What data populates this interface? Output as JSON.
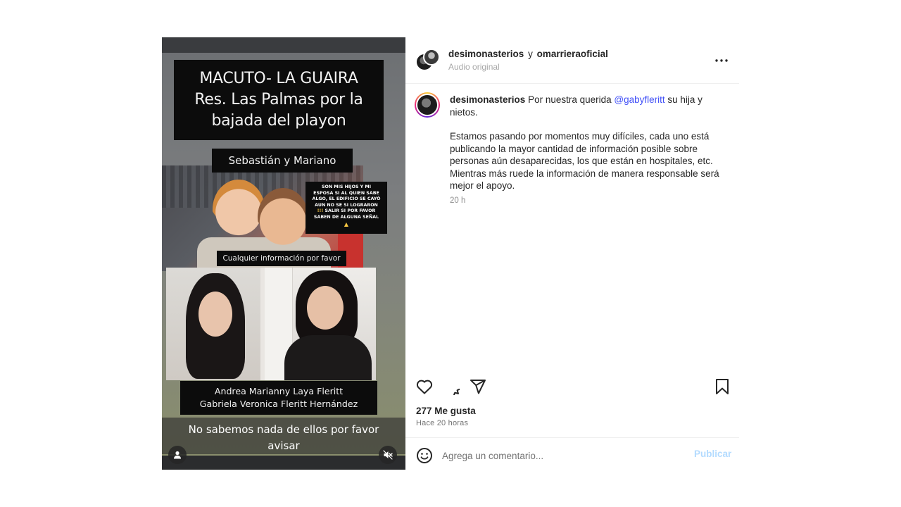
{
  "media": {
    "title_lines": [
      "MACUTO- LA GUAIRA",
      "Res. Las Palmas por la",
      "bajada del playon"
    ],
    "names_label": "Sebastián y Mariano",
    "note_lines": [
      "SON MIS HIJOS Y MI",
      "ESPOSA SI AL QUIEN SABE",
      "ALGO, EL EDIFICIO SE CAYÓ",
      "AUN NO SE SI LOGRARON",
      "SALIR SI POR FAVOR",
      "SABEN DE ALGUNA SEÑAL"
    ],
    "info_label": "Cualquier información por favor",
    "fullnames_lines": [
      "Andrea Marianny Laya Fleritt",
      "Gabriela Veronica Fleritt Hernández"
    ],
    "caption_lines": [
      "No sabemos nada de ellos por favor",
      "avisar"
    ],
    "icons": {
      "user_tag": "user-icon",
      "mute": "speaker-muted-icon",
      "pray": "praying-hands-icon"
    }
  },
  "header": {
    "user1": "desimonasterios",
    "joiner": "y",
    "user2": "omarrieraoficial",
    "audio_label": "Audio original",
    "more_icon": "more-horizontal-icon"
  },
  "caption": {
    "author": "desimonasterios",
    "text_before_mention": "Por nuestra querida",
    "mention": "@gabyfleritt",
    "text_after_mention": "su hija y nietos.",
    "paragraph2": "Estamos pasando por momentos muy difíciles, cada uno está publicando la mayor cantidad de información posible sobre personas aún desaparecidas, los que están en hospitales, etc. Mientras más ruede la información de manera responsable será mejor el apoyo.",
    "time": "20 h"
  },
  "actions": {
    "icons": [
      "heart-icon",
      "comment-icon",
      "share-icon",
      "bookmark-icon"
    ],
    "likes": "277 Me gusta",
    "post_time": "Hace 20 horas"
  },
  "add_comment": {
    "placeholder": "Agrega un comentario...",
    "publish_label": "Publicar",
    "emoji_icon": "smiley-icon"
  },
  "colors": {
    "mention": "#4150f7",
    "publish_disabled": "#b3dbff",
    "muted_text": "#a8a8a8"
  }
}
